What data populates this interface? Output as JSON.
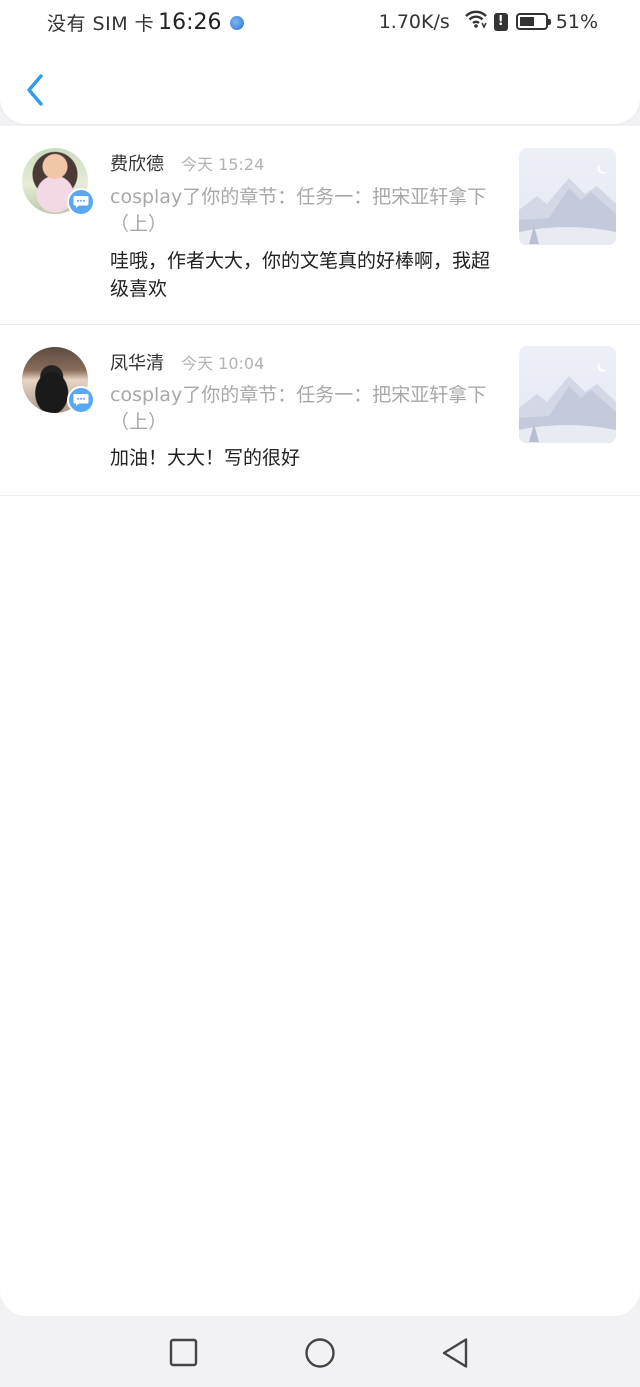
{
  "status_bar": {
    "carrier": "没有 SIM 卡",
    "time": "16:26",
    "speed": "1.70K/s",
    "battery_pct": "51%",
    "battery_level": 0.51,
    "icons": [
      "location-dot-icon",
      "wifi-icon",
      "alert-icon",
      "battery-charging-icon"
    ]
  },
  "nav": {
    "back_icon": "chevron-left-icon",
    "accent_color": "#2d9bf0"
  },
  "messages": [
    {
      "name": "费欣德",
      "time": "今天 15:24",
      "chapter": "cosplay了你的章节：任务一：把宋亚轩拿下（上）",
      "comment": "哇哦，作者大大，你的文笔真的好棒啊，我超级喜欢"
    },
    {
      "name": "凤华清",
      "time": "今天 10:04",
      "chapter": "cosplay了你的章节：任务一：把宋亚轩拿下（上）",
      "comment": "加油！大大！写的很好"
    }
  ],
  "system_nav": {
    "icons": [
      "recents-square-icon",
      "home-circle-icon",
      "back-triangle-icon"
    ]
  }
}
